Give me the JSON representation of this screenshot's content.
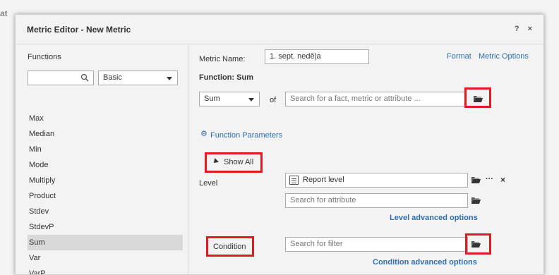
{
  "background_label": "at",
  "dialog": {
    "title": "Metric Editor - New Metric",
    "help_label": "?",
    "close_label": "×"
  },
  "functions_panel": {
    "header": "Functions",
    "search_placeholder": "",
    "category_select": "Basic",
    "items": [
      "Max",
      "Median",
      "Min",
      "Mode",
      "Multiply",
      "Product",
      "Stdev",
      "StdevP",
      "Sum",
      "Var",
      "VarP"
    ],
    "selected": "Sum"
  },
  "metric": {
    "name_label": "Metric Name:",
    "name_value": "1. sept. nedě|a",
    "format_link": "Format",
    "options_link": "Metric Options",
    "function_title": "Function: Sum",
    "function_select": "Sum",
    "of_label": "of",
    "object_placeholder": "Search for a fact, metric or attribute ...",
    "function_params_link": "Function Parameters",
    "show_all": "Show All",
    "level_label": "Level",
    "report_level": "Report level",
    "more_label": "···",
    "remove_label": "×",
    "attribute_placeholder": "Search for attribute",
    "level_advanced": "Level advanced options",
    "condition_label": "Condition",
    "filter_placeholder": "Search for filter",
    "condition_advanced": "Condition advanced options"
  },
  "colors": {
    "highlight": "#e21b23",
    "link": "#2d6fb5",
    "selected_row": "#d9d9d9"
  }
}
